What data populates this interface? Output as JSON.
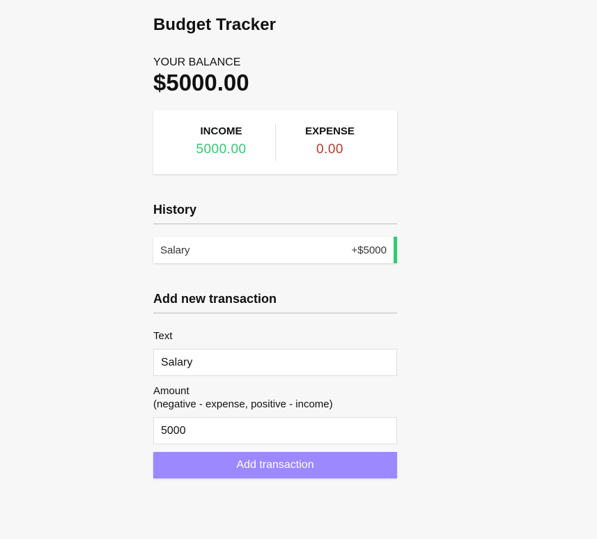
{
  "app": {
    "title": "Budget Tracker"
  },
  "balance": {
    "label": "YOUR BALANCE",
    "value": "$5000.00"
  },
  "summary": {
    "income_label": "INCOME",
    "income_value": "5000.00",
    "expense_label": "EXPENSE",
    "expense_value": "0.00",
    "income_color": "#2ecc71",
    "expense_color": "#c0392b"
  },
  "history": {
    "title": "History",
    "items": [
      {
        "text": "Salary",
        "amount": "+$5000",
        "type": "plus"
      }
    ]
  },
  "form": {
    "title": "Add new transaction",
    "text_label": "Text",
    "text_value": "Salary",
    "amount_label": "Amount",
    "amount_hint": "(negative - expense, positive - income)",
    "amount_value": "5000",
    "submit_label": "Add transaction",
    "submit_color": "#9c88ff"
  }
}
